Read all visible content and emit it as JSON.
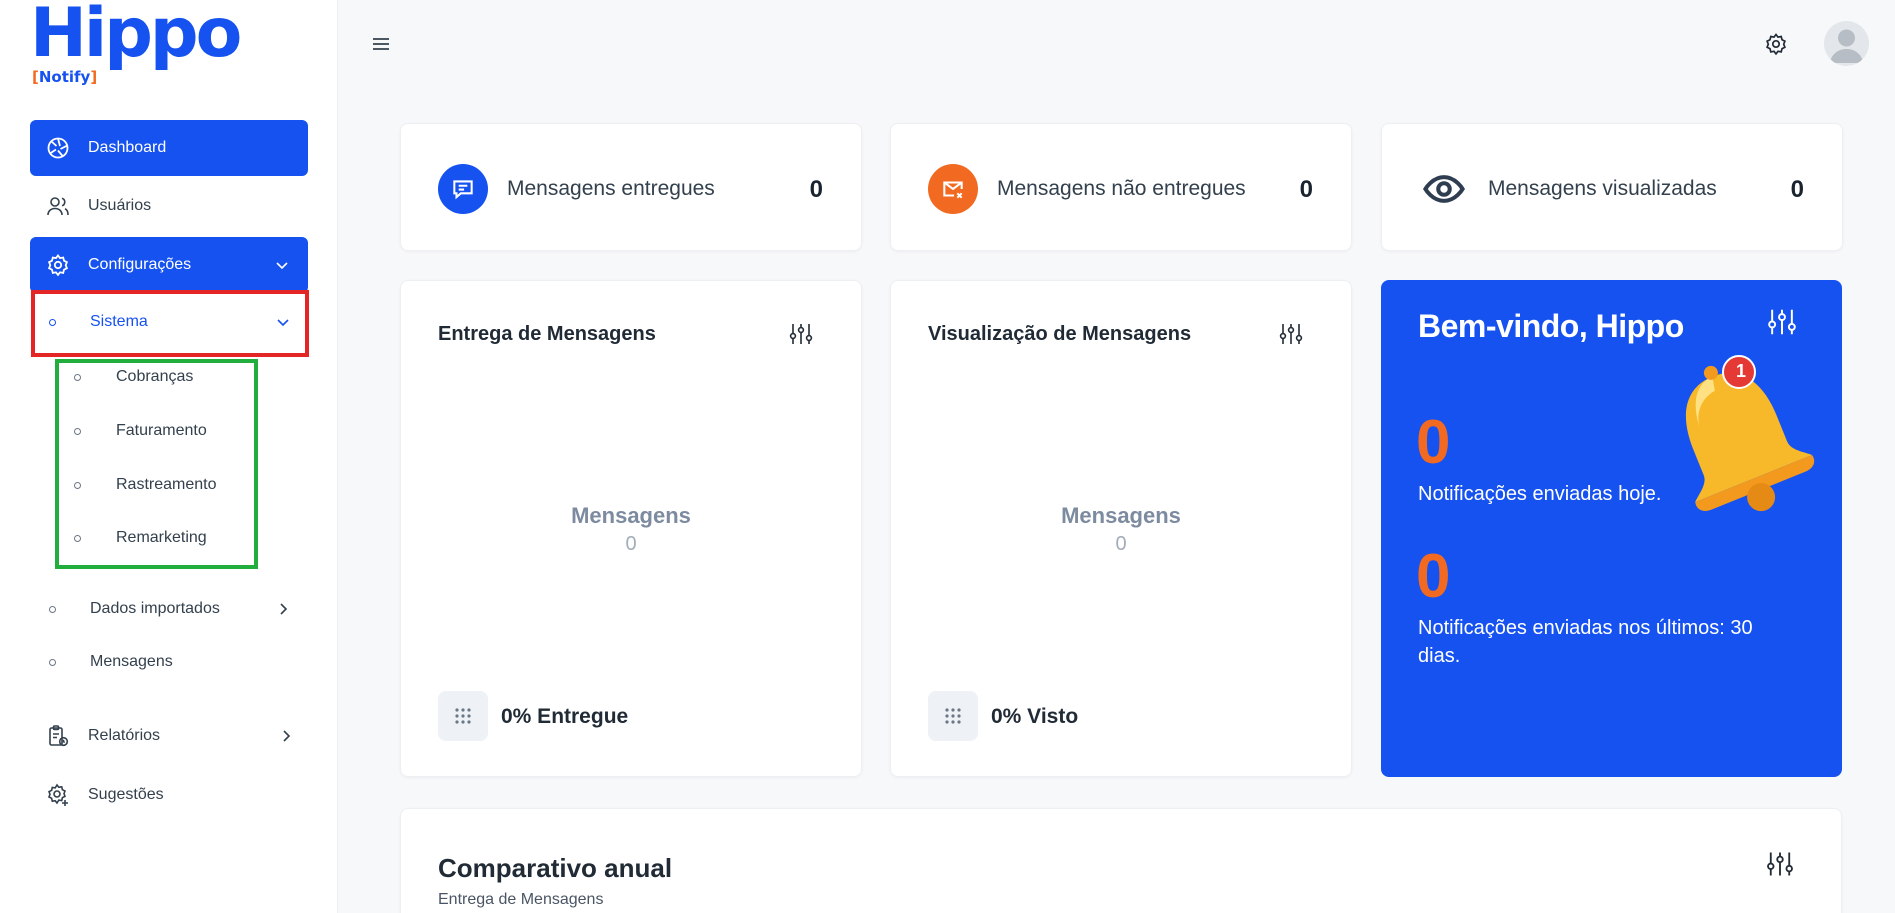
{
  "brand": {
    "name": "Hippo",
    "sub": "Notify",
    "primary": "#1652f0",
    "accent": "#f26a21"
  },
  "sidebar": {
    "items": [
      {
        "label": "Dashboard",
        "icon": "dashboard-icon",
        "active": true
      },
      {
        "label": "Usuários",
        "icon": "users-icon"
      },
      {
        "label": "Configurações",
        "icon": "gear-icon",
        "active": true,
        "expanded": true
      },
      {
        "label": "Relatórios",
        "icon": "report-icon"
      },
      {
        "label": "Sugestões",
        "icon": "gear-plus-icon"
      }
    ],
    "config_sub": [
      {
        "label": "Sistema",
        "selected": true,
        "expanded": true
      },
      {
        "label": "Dados importados"
      },
      {
        "label": "Mensagens"
      }
    ],
    "sistema_sub": [
      "Cobranças",
      "Faturamento",
      "Rastreamento",
      "Remarketing"
    ]
  },
  "header": {
    "menu_icon": "hamburger-icon",
    "settings_icon": "gear-icon",
    "avatar_icon": "user-avatar-icon"
  },
  "stats": [
    {
      "label": "Mensagens entregues",
      "value": "0",
      "icon": "message-icon",
      "color": "#1652f0"
    },
    {
      "label": "Mensagens não entregues",
      "value": "0",
      "icon": "mail-x-icon",
      "color": "#f26a21"
    },
    {
      "label": "Mensagens visualizadas",
      "value": "0",
      "icon": "eye-icon"
    }
  ],
  "charts": [
    {
      "title": "Entrega de Mensagens",
      "center_label": "Mensagens",
      "center_value": "0",
      "footer": "0% Entregue"
    },
    {
      "title": "Visualização de Mensagens",
      "center_label": "Mensagens",
      "center_value": "0",
      "footer": "0% Visto"
    }
  ],
  "welcome": {
    "title": "Bem-vindo, Hippo",
    "today_value": "0",
    "today_label": "Notificações enviadas hoje.",
    "month_value": "0",
    "month_label": "Notificações enviadas nos últimos: 30 dias.",
    "bell_badge": "1"
  },
  "annual": {
    "title": "Comparativo anual",
    "subtitle": "Entrega de Mensagens"
  }
}
